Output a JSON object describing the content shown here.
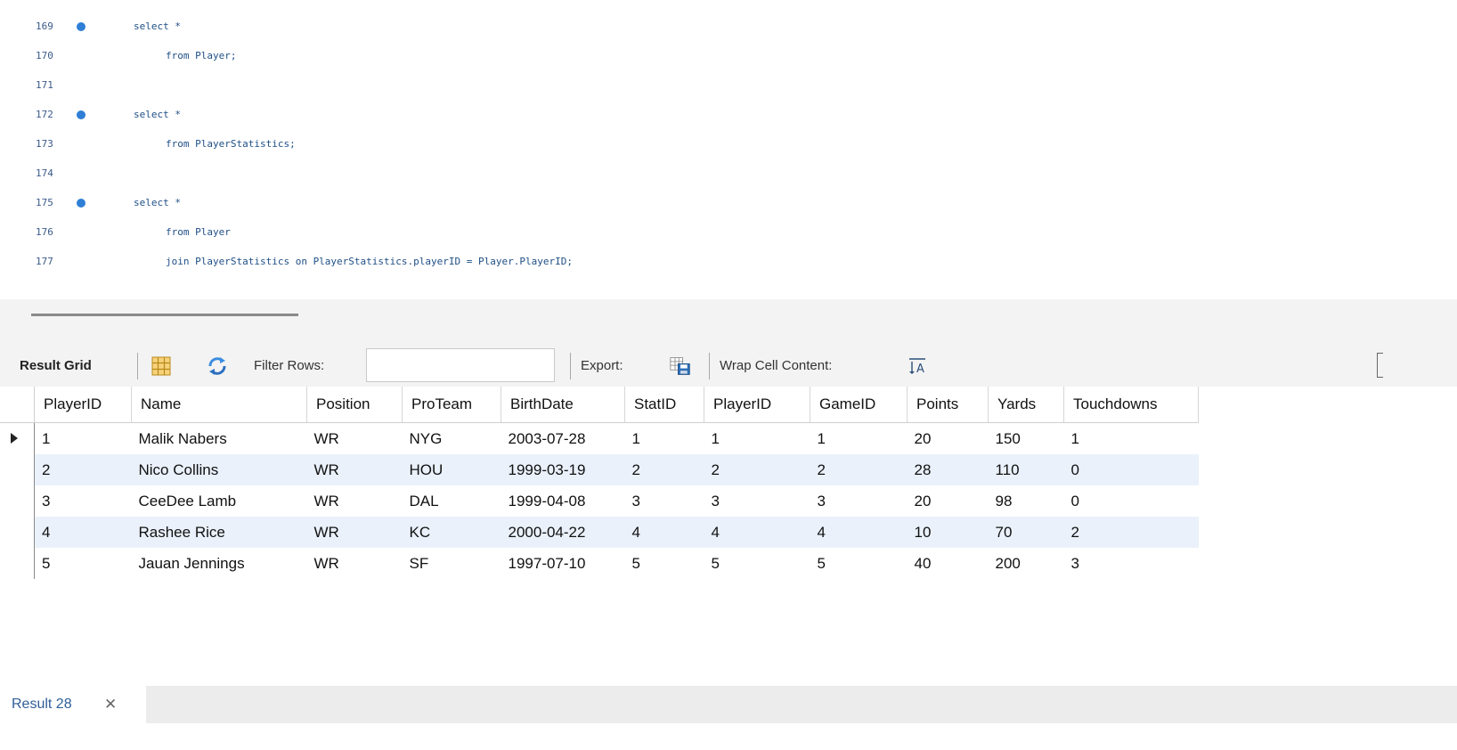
{
  "editor": {
    "lines": [
      {
        "num": "169",
        "bp": true,
        "indent": 0,
        "text": "select *"
      },
      {
        "num": "170",
        "bp": false,
        "indent": 1,
        "text": "from Player;"
      },
      {
        "num": "171",
        "bp": false,
        "indent": 0,
        "text": ""
      },
      {
        "num": "172",
        "bp": true,
        "indent": 0,
        "text": "select *"
      },
      {
        "num": "173",
        "bp": false,
        "indent": 1,
        "text": "from PlayerStatistics;"
      },
      {
        "num": "174",
        "bp": false,
        "indent": 0,
        "text": ""
      },
      {
        "num": "175",
        "bp": true,
        "indent": 0,
        "text": "select *"
      },
      {
        "num": "176",
        "bp": false,
        "indent": 1,
        "text": "from Player"
      },
      {
        "num": "177",
        "bp": false,
        "indent": 1,
        "text": "join PlayerStatistics on PlayerStatistics.playerID = Player.PlayerID;"
      }
    ]
  },
  "toolbar": {
    "result_grid_label": "Result Grid",
    "filter_rows_label": "Filter Rows:",
    "filter_value": "",
    "export_label": "Export:",
    "wrap_label": "Wrap Cell Content:",
    "icons": {
      "grid_view": "grid-view-icon",
      "refresh": "refresh-icon",
      "export": "export-icon",
      "wrap": "wrap-text-icon"
    }
  },
  "grid": {
    "columns": [
      "PlayerID",
      "Name",
      "Position",
      "ProTeam",
      "BirthDate",
      "StatID",
      "PlayerID",
      "GameID",
      "Points",
      "Yards",
      "Touchdowns"
    ],
    "rows": [
      [
        "1",
        "Malik Nabers",
        "WR",
        "NYG",
        "2003-07-28",
        "1",
        "1",
        "1",
        "20",
        "150",
        "1"
      ],
      [
        "2",
        "Nico Collins",
        "WR",
        "HOU",
        "1999-03-19",
        "2",
        "2",
        "2",
        "28",
        "110",
        "0"
      ],
      [
        "3",
        "CeeDee Lamb",
        "WR",
        "DAL",
        "1999-04-08",
        "3",
        "3",
        "3",
        "20",
        "98",
        "0"
      ],
      [
        "4",
        "Rashee Rice",
        "WR",
        "KC",
        "2000-04-22",
        "4",
        "4",
        "4",
        "10",
        "70",
        "2"
      ],
      [
        "5",
        "Jauan Jennings",
        "WR",
        "SF",
        "1997-07-10",
        "5",
        "5",
        "5",
        "40",
        "200",
        "3"
      ]
    ],
    "current_row": 0
  },
  "tabs": {
    "result_tab_label": "Result 28",
    "close_glyph": "✕"
  },
  "colors": {
    "accent_blue": "#2f7fd6",
    "alt_row": "#eaf1fb",
    "tab_text": "#2f5d98"
  }
}
